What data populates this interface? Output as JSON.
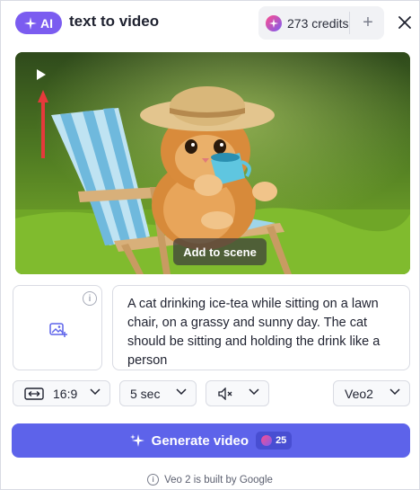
{
  "header": {
    "ai_badge": "AI",
    "title": "text to video",
    "credits_label": "273 credits",
    "add_credits_symbol": "+",
    "close_icon": "close-icon"
  },
  "preview": {
    "play_icon": "play-icon",
    "add_to_scene_label": "Add to scene"
  },
  "prompt": {
    "image_slot_icon": "image-add-icon",
    "info_symbol": "i",
    "text": "A cat drinking ice-tea while sitting on a lawn chair, on a grassy and sunny day. The cat should be sitting and holding the drink like a person"
  },
  "options": {
    "aspect_ratio": "16:9",
    "duration": "5 sec",
    "model": "Veo2"
  },
  "generate": {
    "label": "Generate video",
    "cost": "25"
  },
  "footer": {
    "info_symbol": "i",
    "text": "Veo 2 is built by Google"
  },
  "colors": {
    "accent": "#5d63ea",
    "ai_badge": "#7b5cf0",
    "arrow": "#e5393b"
  }
}
